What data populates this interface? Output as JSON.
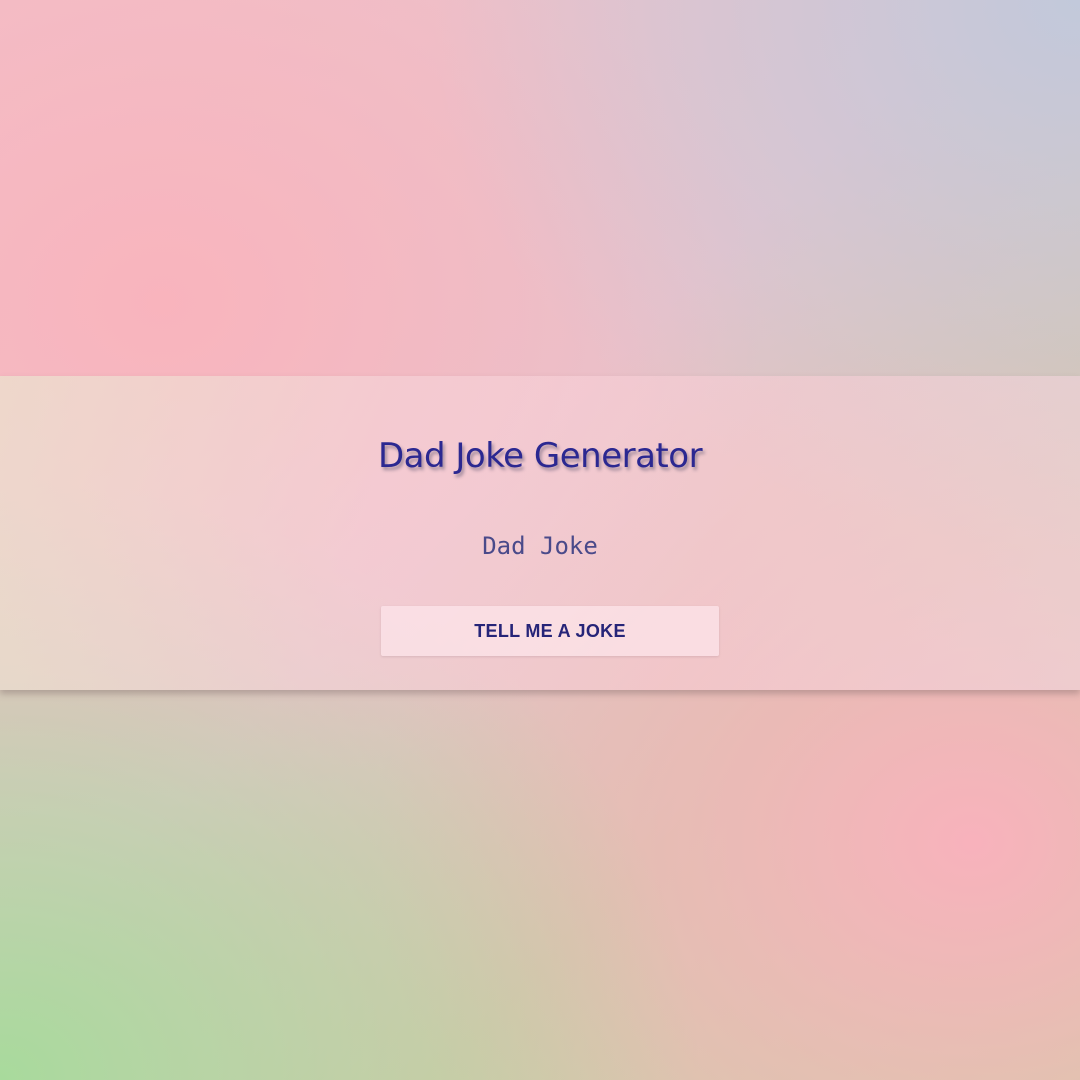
{
  "app": {
    "title": "Dad Joke Generator",
    "joke": "Dad Joke",
    "button_label": "TELL ME A JOKE"
  },
  "colors": {
    "title": "#2b2891",
    "joke_text": "#4a4a8a",
    "button_text": "#262478"
  }
}
